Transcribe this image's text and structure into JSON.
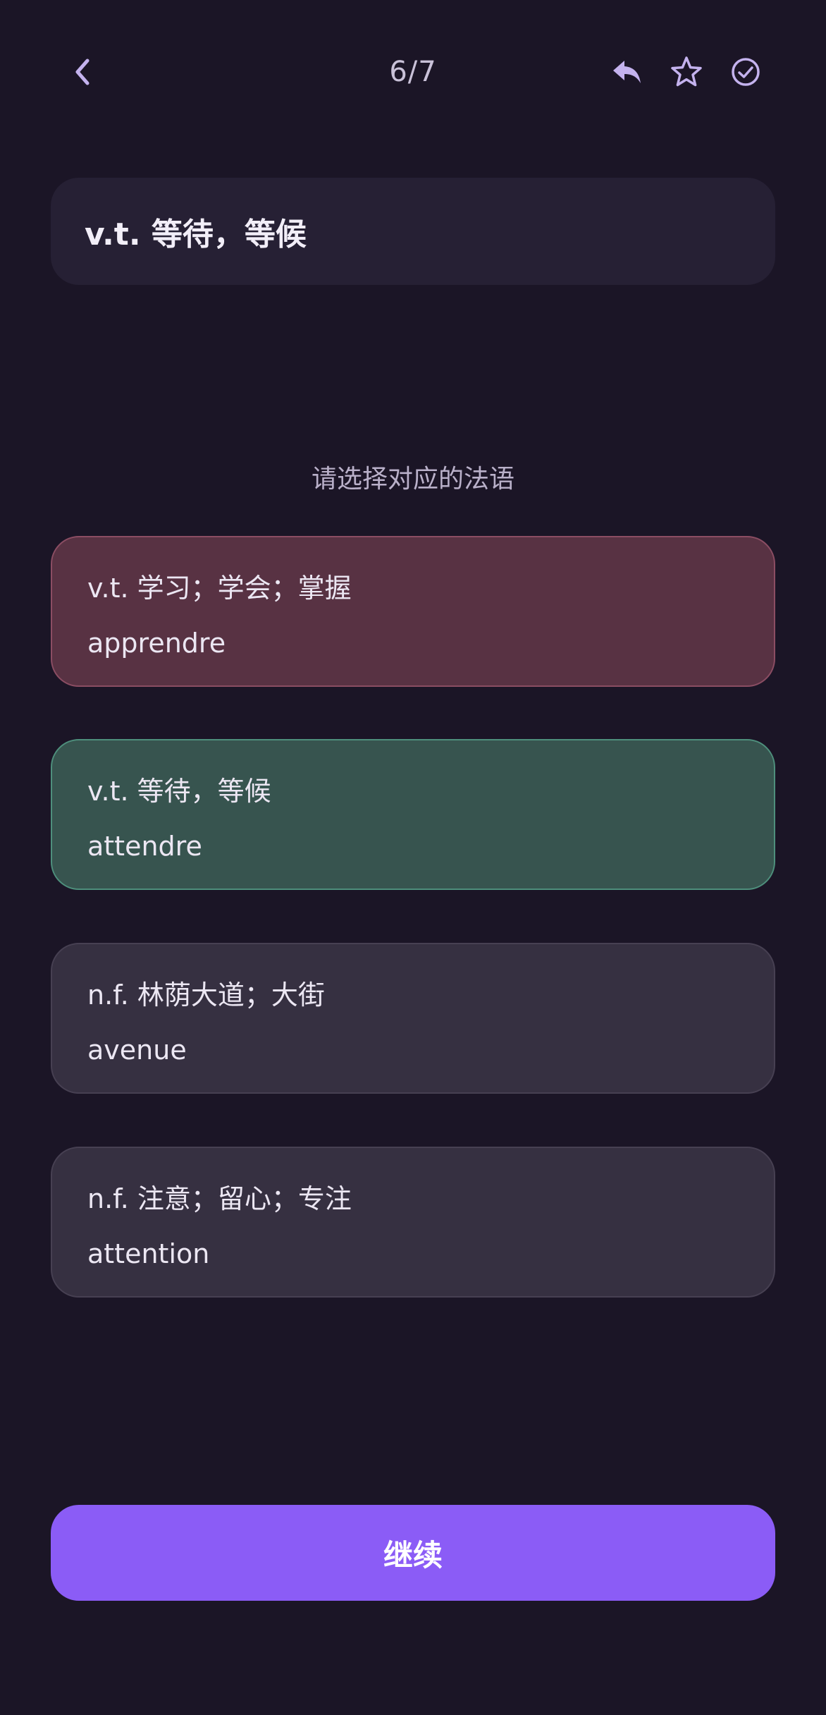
{
  "header": {
    "progress": "6/7",
    "back_icon": "chevron-left-icon",
    "actions": [
      {
        "icon": "reply-icon"
      },
      {
        "icon": "star-icon"
      },
      {
        "icon": "check-circle-icon"
      }
    ],
    "icon_color": "#c4b2ee"
  },
  "prompt": {
    "text": "v.t. 等待，等候"
  },
  "instruction": "请选择对应的法语",
  "options": [
    {
      "meaning": "v.t. 学习；学会；掌握",
      "word": "apprendre",
      "state": "wrong",
      "color": "#583243"
    },
    {
      "meaning": "v.t. 等待，等候",
      "word": "attendre",
      "state": "correct",
      "color": "#37544f"
    },
    {
      "meaning": "n.f. 林荫大道；大街",
      "word": "avenue",
      "state": "neutral",
      "color": "#363041"
    },
    {
      "meaning": "n.f. 注意；留心；专注",
      "word": "attention",
      "state": "neutral",
      "color": "#363041"
    }
  ],
  "continue_label": "继续",
  "colors": {
    "background": "#1b1526",
    "accent": "#8b5cf6"
  }
}
